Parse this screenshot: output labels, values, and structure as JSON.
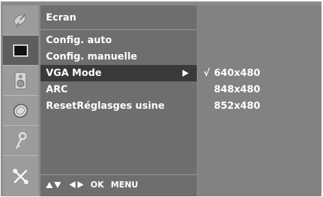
{
  "sidebar": {
    "icons": [
      {
        "name": "satellite-dish-icon"
      },
      {
        "name": "screen-icon"
      },
      {
        "name": "speaker-icon"
      },
      {
        "name": "clock-icon"
      },
      {
        "name": "key-icon"
      },
      {
        "name": "tools-icon"
      }
    ],
    "selected_index": 1
  },
  "menu": {
    "title": "Ecran",
    "items": [
      {
        "label": "Config. auto"
      },
      {
        "label": "Config. manuelle"
      },
      {
        "label": "VGA Mode",
        "selected": true
      },
      {
        "label": "ARC"
      },
      {
        "label": "ResetRéglasges usine"
      }
    ],
    "nav_hint": {
      "ok": "OK",
      "menu": "MENU"
    }
  },
  "submenu": {
    "items": [
      {
        "check": "√",
        "label": "640x480"
      },
      {
        "check": "",
        "label": "848x480"
      },
      {
        "check": "",
        "label": "852x480"
      }
    ]
  }
}
